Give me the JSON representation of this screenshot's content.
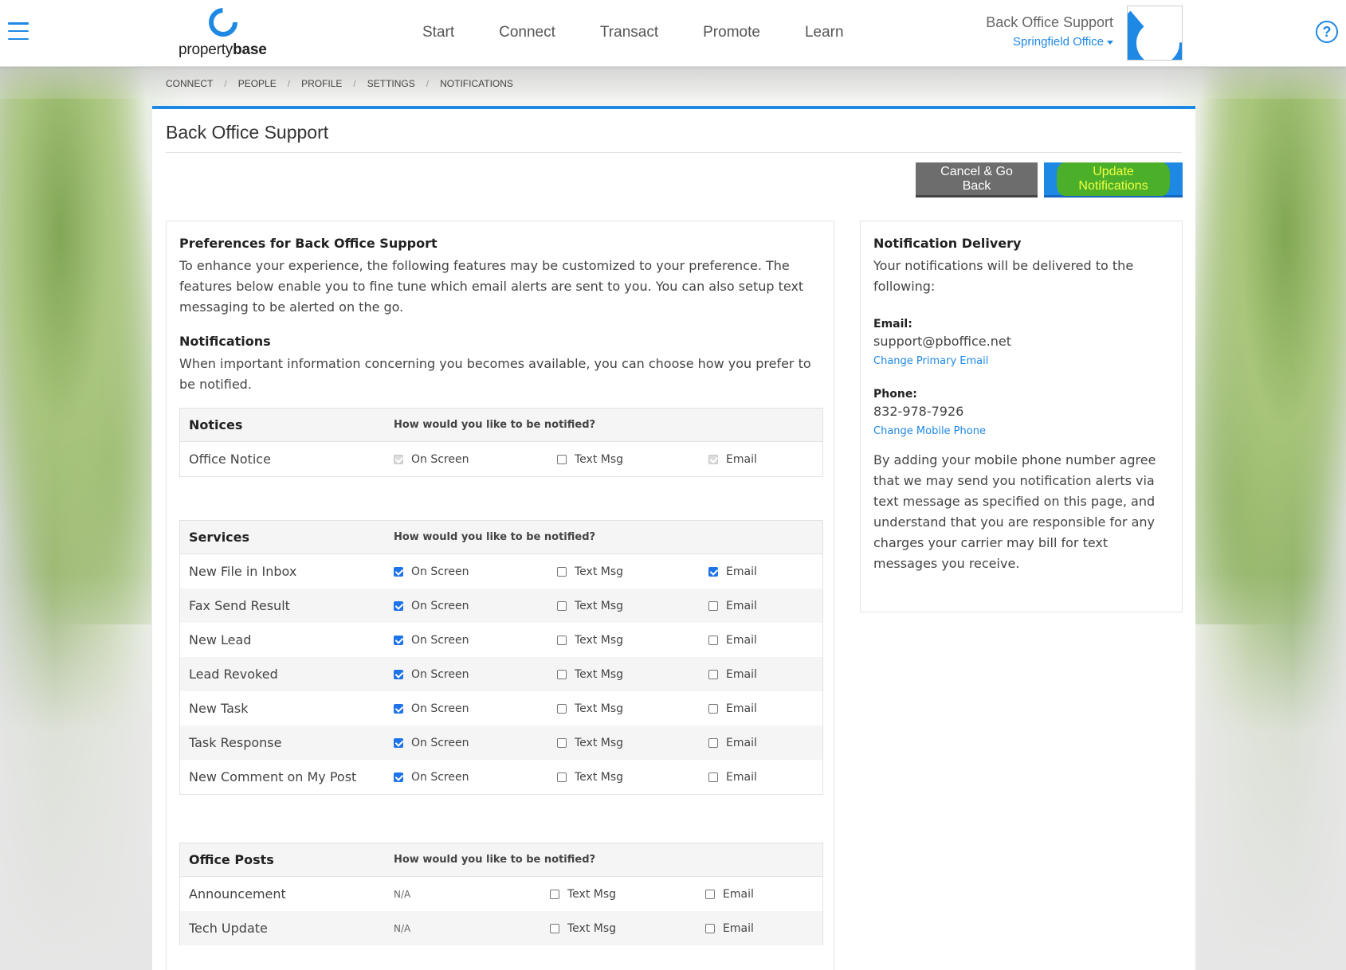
{
  "header": {
    "logo_prefix": "property",
    "logo_suffix": "base",
    "nav": [
      "Start",
      "Connect",
      "Transact",
      "Promote",
      "Learn"
    ],
    "user_name": "Back Office Support",
    "office": "Springfield Office"
  },
  "breadcrumb": [
    "CONNECT",
    "PEOPLE",
    "PROFILE",
    "SETTINGS",
    "NOTIFICATIONS"
  ],
  "page": {
    "title": "Back Office Support",
    "cancel_label": "Cancel & Go Back",
    "update_label": "Update Notifications"
  },
  "prefs": {
    "heading": "Preferences for Back Office Support",
    "intro": "To enhance your experience, the following features may be customized to your preference. The features below enable you to fine tune which email alerts are sent to you. You can also setup text messaging to be alerted on the go.",
    "notifications_heading": "Notifications",
    "notifications_text": "When important information concerning you becomes available, you can choose how you prefer to be notified.",
    "question": "How would you like to be notified?",
    "opt_screen": "On Screen",
    "opt_text": "Text Msg",
    "opt_email": "Email",
    "na": "N/A",
    "notices": {
      "title": "Notices",
      "rows": [
        {
          "label": "Office Notice",
          "screen": "disabled-checked",
          "text": false,
          "email": "disabled-checked"
        }
      ]
    },
    "services": {
      "title": "Services",
      "rows": [
        {
          "label": "New File in Inbox",
          "screen": true,
          "text": false,
          "email": true
        },
        {
          "label": "Fax Send Result",
          "screen": true,
          "text": false,
          "email": false
        },
        {
          "label": "New Lead",
          "screen": true,
          "text": false,
          "email": false
        },
        {
          "label": "Lead Revoked",
          "screen": true,
          "text": false,
          "email": false
        },
        {
          "label": "New Task",
          "screen": true,
          "text": false,
          "email": false
        },
        {
          "label": "Task Response",
          "screen": true,
          "text": false,
          "email": false
        },
        {
          "label": "New Comment on My Post",
          "screen": true,
          "text": false,
          "email": false
        }
      ]
    },
    "office_posts": {
      "title": "Office Posts",
      "rows": [
        {
          "label": "Announcement",
          "text": false,
          "email": false
        },
        {
          "label": "Tech Update",
          "text": false,
          "email": false
        }
      ]
    }
  },
  "delivery": {
    "heading": "Notification Delivery",
    "intro": "Your notifications will be delivered to the following:",
    "email_label": "Email:",
    "email_value": "support@pboffice.net",
    "change_email": "Change Primary Email",
    "phone_label": "Phone:",
    "phone_value": "832-978-7926",
    "change_phone": "Change Mobile Phone",
    "consent": "By adding your mobile phone number agree that we may send you notification alerts via text message as specified on this page, and understand that you are responsible for any charges your carrier may bill for text messages you receive."
  },
  "colors": {
    "accent": "#1e88e5",
    "cancel": "#6d6d6d",
    "highlight": "#4caf2a"
  }
}
